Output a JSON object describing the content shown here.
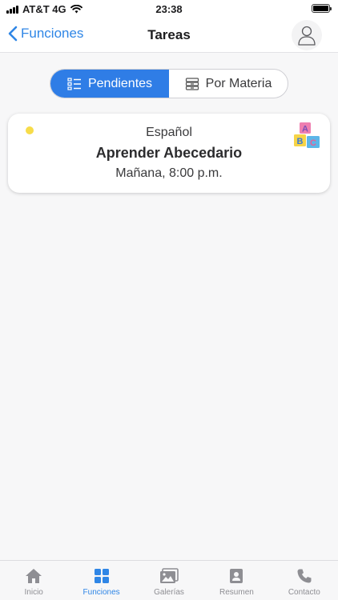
{
  "status_bar": {
    "carrier": "AT&T 4G",
    "time": "23:38",
    "battery_level": 1.0
  },
  "nav": {
    "back_label": "Funciones",
    "title": "Tareas"
  },
  "segmented": {
    "active_label": "Pendientes",
    "inactive_label": "Por Materia"
  },
  "task": {
    "subject": "Español",
    "title": "Aprender Abecedario",
    "due": "Mañana, 8:00 p.m.",
    "status_color": "#f7dc4a",
    "icon": "abc-blocks-icon"
  },
  "tabs": [
    {
      "label": "Inicio",
      "icon": "home-icon"
    },
    {
      "label": "Funciones",
      "icon": "grid-icon"
    },
    {
      "label": "Galerías",
      "icon": "gallery-icon"
    },
    {
      "label": "Resumen",
      "icon": "profile-card-icon"
    },
    {
      "label": "Contacto",
      "icon": "phone-icon"
    }
  ],
  "colors": {
    "accent": "#2f86e6",
    "segment_active": "#2f7de6",
    "inactive": "#8e8e93"
  }
}
